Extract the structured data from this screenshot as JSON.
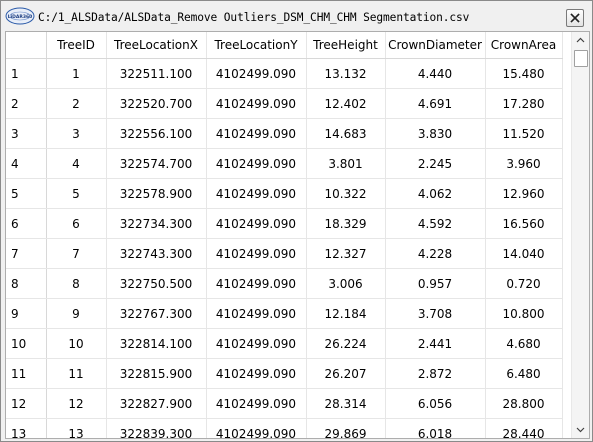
{
  "window": {
    "title": "C:/1_ALSData/ALSData_Remove Outliers_DSM_CHM_CHM Segmentation.csv",
    "icon": "lidar-app-icon",
    "icon_text": "LiDAR360",
    "close_icon": "close-icon"
  },
  "table": {
    "columns": [
      "",
      "TreeID",
      "TreeLocationX",
      "TreeLocationY",
      "TreeHeight",
      "CrownDiameter",
      "CrownArea"
    ],
    "rows": [
      {
        "num": "1",
        "cells": [
          "1",
          "322511.100",
          "4102499.090",
          "13.132",
          "4.440",
          "15.480"
        ]
      },
      {
        "num": "2",
        "cells": [
          "2",
          "322520.700",
          "4102499.090",
          "12.402",
          "4.691",
          "17.280"
        ]
      },
      {
        "num": "3",
        "cells": [
          "3",
          "322556.100",
          "4102499.090",
          "14.683",
          "3.830",
          "11.520"
        ]
      },
      {
        "num": "4",
        "cells": [
          "4",
          "322574.700",
          "4102499.090",
          "3.801",
          "2.245",
          "3.960"
        ]
      },
      {
        "num": "5",
        "cells": [
          "5",
          "322578.900",
          "4102499.090",
          "10.322",
          "4.062",
          "12.960"
        ]
      },
      {
        "num": "6",
        "cells": [
          "6",
          "322734.300",
          "4102499.090",
          "18.329",
          "4.592",
          "16.560"
        ]
      },
      {
        "num": "7",
        "cells": [
          "7",
          "322743.300",
          "4102499.090",
          "12.327",
          "4.228",
          "14.040"
        ]
      },
      {
        "num": "8",
        "cells": [
          "8",
          "322750.500",
          "4102499.090",
          "3.006",
          "0.957",
          "0.720"
        ]
      },
      {
        "num": "9",
        "cells": [
          "9",
          "322767.300",
          "4102499.090",
          "12.184",
          "3.708",
          "10.800"
        ]
      },
      {
        "num": "10",
        "cells": [
          "10",
          "322814.100",
          "4102499.090",
          "26.224",
          "2.441",
          "4.680"
        ]
      },
      {
        "num": "11",
        "cells": [
          "11",
          "322815.900",
          "4102499.090",
          "26.207",
          "2.872",
          "6.480"
        ]
      },
      {
        "num": "12",
        "cells": [
          "12",
          "322827.900",
          "4102499.090",
          "28.314",
          "6.056",
          "28.800"
        ]
      },
      {
        "num": "13",
        "cells": [
          "13",
          "322839.300",
          "4102499.090",
          "29.869",
          "6.018",
          "28.440"
        ]
      }
    ]
  },
  "scrollbar": {
    "up_icon": "scroll-up-arrow-icon",
    "down_icon": "scroll-down-arrow-icon",
    "position": 0.0
  }
}
